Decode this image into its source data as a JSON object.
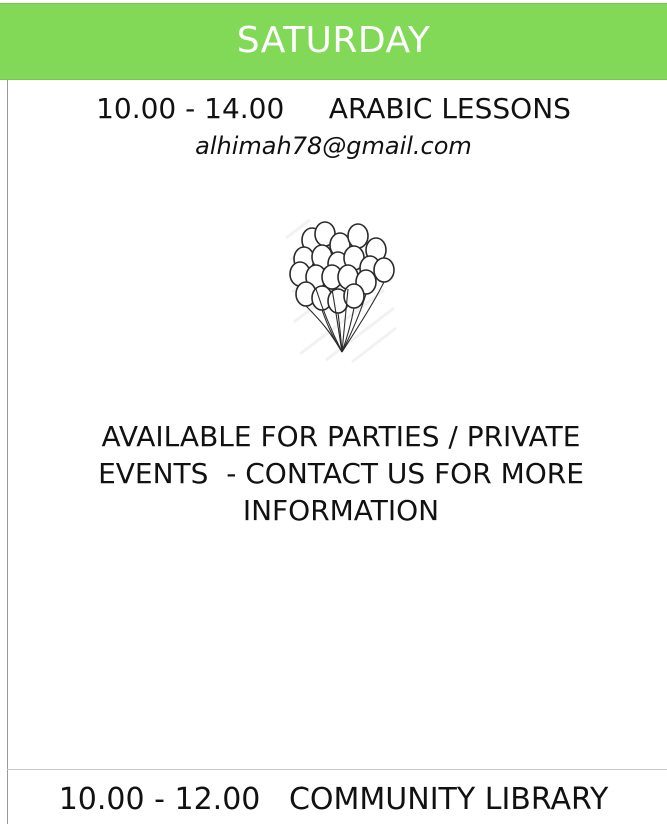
{
  "schedule": {
    "day": "SATURDAY",
    "colors": {
      "header_background": "#82d957",
      "header_text": "#ffffff",
      "body_text": "#111111"
    },
    "sessions": [
      {
        "line": "10.00 - 14.00     ARABIC LESSONS",
        "email": "alhimah78@gmail.com"
      },
      {
        "line": "10.00 - 12.00   COMMUNITY LIBRARY"
      }
    ],
    "illustration": "balloons-icon",
    "notice_lines": [
      "AVAILABLE FOR PARTIES / PRIVATE",
      "EVENTS  - CONTACT US FOR MORE",
      "INFORMATION"
    ]
  }
}
